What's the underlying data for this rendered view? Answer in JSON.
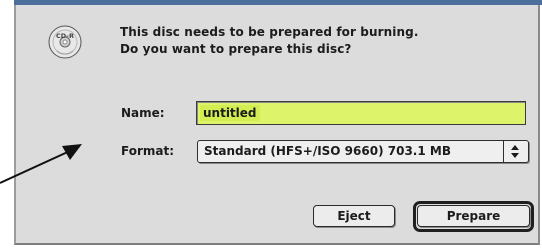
{
  "dialog": {
    "message_line1": "This disc needs to be prepared for burning.",
    "message_line2": "Do you want to prepare this disc?",
    "icon": "cd-rw-disc-icon",
    "icon_label": "CD-R"
  },
  "form": {
    "name_label": "Name:",
    "name_value": "untitled",
    "format_label": "Format:",
    "format_value": "Standard (HFS+/ISO 9660) 703.1 MB"
  },
  "buttons": {
    "eject": "Eject",
    "prepare": "Prepare"
  },
  "colors": {
    "dialog_bg": "#dcdcdc",
    "title_strip": "#4d6f9c",
    "name_field_highlight": "#ddf46a"
  },
  "annotation": {
    "icon": "pointer-arrow-icon"
  }
}
